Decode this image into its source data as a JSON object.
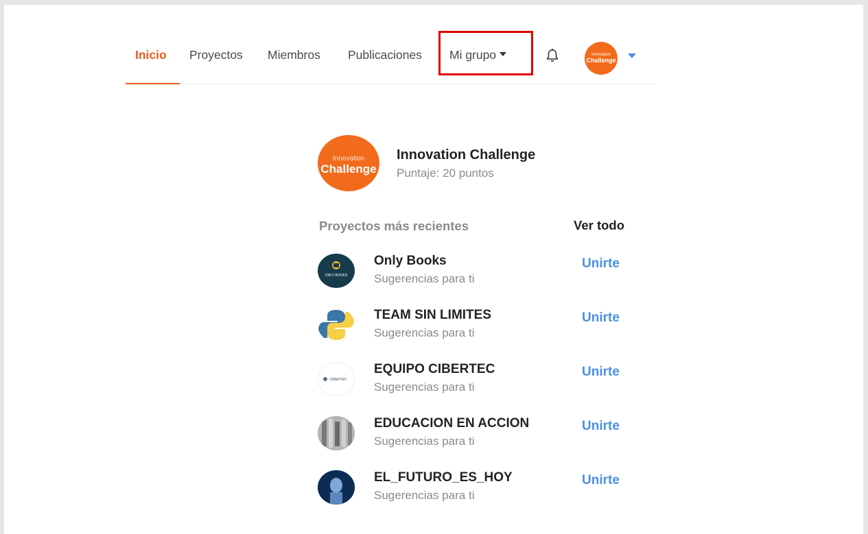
{
  "nav": {
    "items": [
      {
        "label": "Inicio",
        "active": true
      },
      {
        "label": "Proyectos"
      },
      {
        "label": "Miembros"
      },
      {
        "label": "Publicaciones"
      }
    ],
    "dropdown_label": "Mi grupo",
    "notification_icon": "bell-icon",
    "highlight_color": "#e00000",
    "accent_color": "#ea5b1f"
  },
  "group": {
    "logo_line1": "Innovation",
    "logo_line2": "Challenge",
    "name": "Innovation Challenge",
    "score": "Puntaje: 20 puntos"
  },
  "recent": {
    "title": "Proyectos más recientes",
    "see_all": "Ver todo",
    "projects": [
      {
        "name": "Only Books",
        "subtitle": "Sugerencias para ti",
        "action": "Unirte",
        "logo_text": "ONLY BOOKS"
      },
      {
        "name": "TEAM SIN LIMITES",
        "subtitle": "Sugerencias para ti",
        "action": "Unirte"
      },
      {
        "name": "EQUIPO CIBERTEC",
        "subtitle": "Sugerencias para ti",
        "action": "Unirte",
        "logo_text": "CIBERTEC"
      },
      {
        "name": "EDUCACION EN ACCION",
        "subtitle": "Sugerencias para ti",
        "action": "Unirte"
      },
      {
        "name": "EL_FUTURO_ES_HOY",
        "subtitle": "Sugerencias para ti",
        "action": "Unirte"
      }
    ]
  }
}
